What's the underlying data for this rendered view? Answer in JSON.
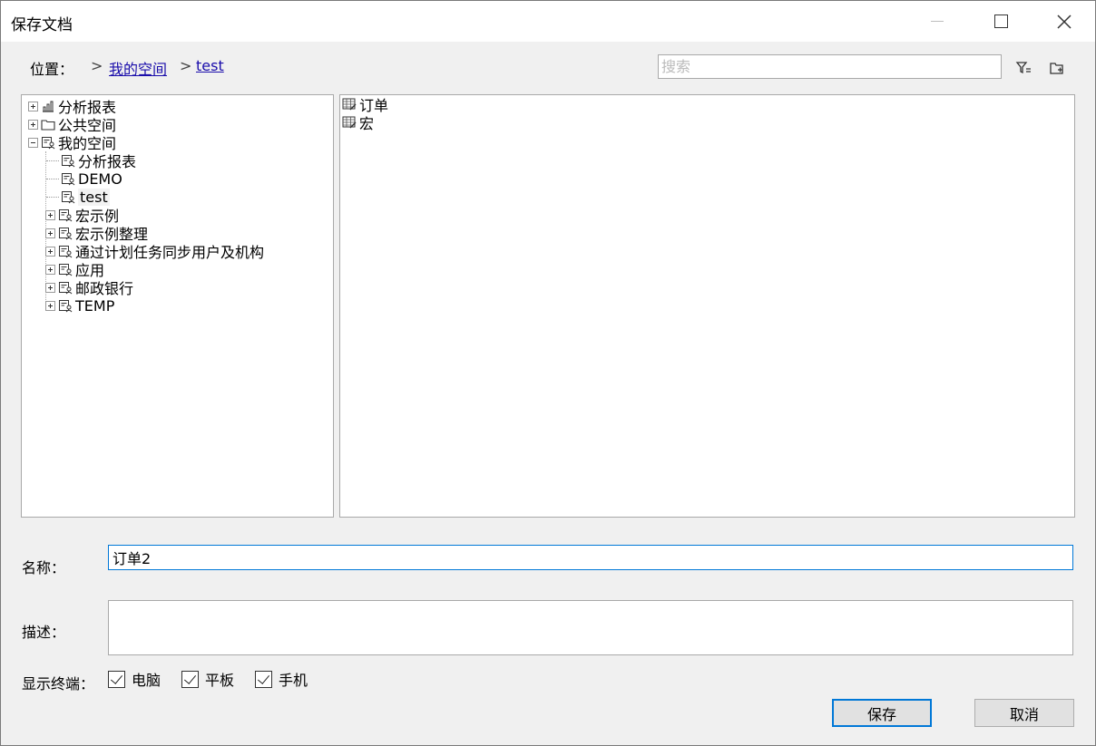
{
  "window": {
    "title": "保存文档"
  },
  "location": {
    "label": "位置：",
    "breadcrumbs": [
      {
        "label": "我的空间"
      },
      {
        "label": "test"
      }
    ],
    "separator": ">"
  },
  "search": {
    "placeholder": "搜索",
    "value": ""
  },
  "tree": {
    "items": [
      {
        "label": "分析报表",
        "icon": "chart-icon",
        "expander": "plus"
      },
      {
        "label": "公共空间",
        "icon": "folder-icon",
        "expander": "plus"
      },
      {
        "label": "我的空间",
        "icon": "user-space-icon",
        "expander": "minus"
      },
      {
        "label": "分析报表",
        "icon": "user-space-icon"
      },
      {
        "label": "DEMO",
        "icon": "user-space-icon"
      },
      {
        "label": "test",
        "icon": "user-space-icon",
        "selected": true
      },
      {
        "label": "宏示例",
        "icon": "user-space-icon",
        "expander": "plus"
      },
      {
        "label": "宏示例整理",
        "icon": "user-space-icon",
        "expander": "plus"
      },
      {
        "label": "通过计划任务同步用户及机构",
        "icon": "user-space-icon",
        "expander": "plus"
      },
      {
        "label": "应用",
        "icon": "user-space-icon",
        "expander": "plus"
      },
      {
        "label": "邮政银行",
        "icon": "user-space-icon",
        "expander": "plus"
      },
      {
        "label": "TEMP",
        "icon": "user-space-icon",
        "expander": "plus"
      }
    ]
  },
  "files": {
    "items": [
      {
        "label": "订单",
        "icon": "table-icon"
      },
      {
        "label": "宏",
        "icon": "table-icon"
      }
    ]
  },
  "form": {
    "name_label": "名称：",
    "name_value": "订单2",
    "desc_label": "描述：",
    "desc_value": "",
    "terminal_label": "显示终端：",
    "terminals": [
      {
        "label": "电脑",
        "checked": true
      },
      {
        "label": "平板",
        "checked": true
      },
      {
        "label": "手机",
        "checked": true
      }
    ]
  },
  "buttons": {
    "save": "保存",
    "cancel": "取消"
  },
  "colors": {
    "accent": "#0078d7",
    "link": "#1a0dab"
  }
}
